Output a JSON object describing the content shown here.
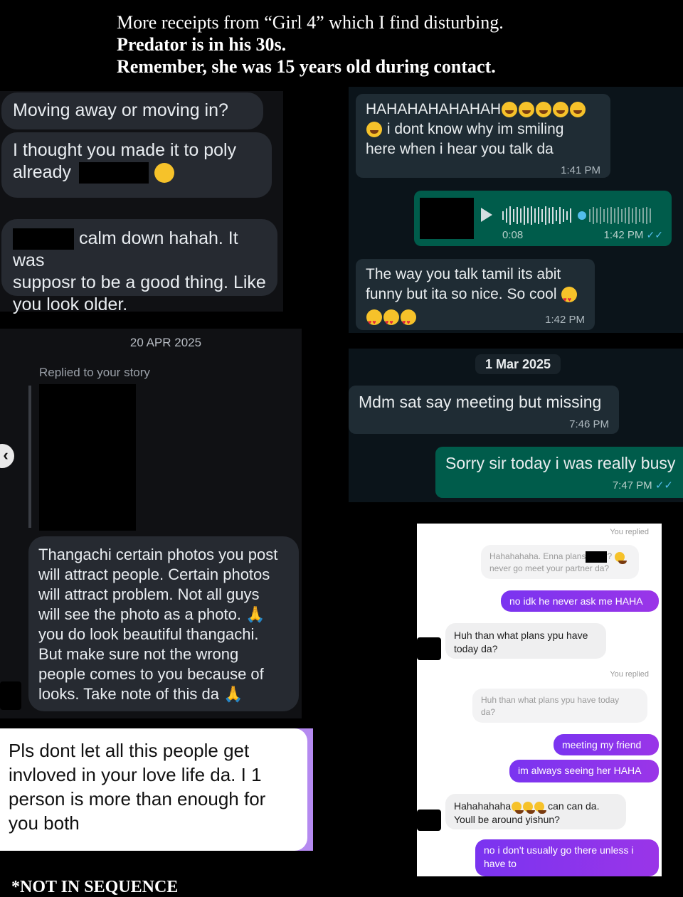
{
  "caption": {
    "line1": "More receipts from “Girl 4” which I find disturbing.",
    "line2": "Predator is in his 30s.",
    "line3": "Remember, she was 15 years old during contact."
  },
  "left_top": {
    "msg1": "Moving away or moving in?",
    "msg2_a": "I thought you made it to poly",
    "msg2_b": "already",
    "msg3_a": "calm down hahah. It was",
    "msg3_b": "supposr to be a good thing. Like",
    "msg3_c": "you look older."
  },
  "left_mid": {
    "date": "20 APR 2025",
    "replied": "Replied to your story",
    "msg_lines": [
      "Thangachi certain photos you post",
      "will attract people. Certain photos",
      "will attract problem. Not all guys",
      "will see the photo as a photo.",
      "you do look beautiful thangachi.",
      "But make sure not the wrong",
      "people comes to you because of",
      "looks. Take note of this da"
    ]
  },
  "left_bottom": {
    "lines": [
      "Pls dont let all this people get",
      "invloved in your love life da. I 1",
      "person is more than enough for",
      "you both"
    ]
  },
  "footer": "*NOT IN SEQUENCE",
  "wa_top": {
    "msg1_a": "HAHAHAHAHAHAH",
    "msg1_b": "i dont know why im smiling",
    "msg1_c": "here when i hear you talk da",
    "msg1_time": "1:41 PM",
    "voice_duration": "0:08",
    "voice_time": "1:42 PM",
    "msg2_a": "The way you talk tamil its abit",
    "msg2_b": "funny but ita so nice. So cool",
    "msg2_time": "1:42 PM"
  },
  "wa_mid": {
    "date": "1 Mar 2025",
    "in_text": "Mdm sat say meeting but missing",
    "in_time": "7:46 PM",
    "out_text": "Sorry sir today i was really busy",
    "out_time": "7:47 PM"
  },
  "insta": {
    "you_replied_1": "You replied",
    "quoted1_a": "Hahahahaha. Enna plans",
    "quoted1_b": "never go meet your partner da?",
    "out1": "no idk he never ask me HAHA",
    "in1_a": "Huh than what plans ypu have",
    "in1_b": "today da?",
    "you_replied_2": "You replied",
    "quoted2_a": "Huh than what plans ypu have today",
    "quoted2_b": "da?",
    "out2": "meeting my friend",
    "out3": "im always seeing her HAHA",
    "in2_a": "Hahahahaha",
    "in2_a2": "can can da.",
    "in2_b": "Youll be around yishun?",
    "out4_a": "no i don't usually go there unless i",
    "out4_b": "have to"
  },
  "colors": {
    "wa_green": "#005c4b",
    "ig_purple": "#7a34f0",
    "check_blue": "#53bdeb"
  }
}
